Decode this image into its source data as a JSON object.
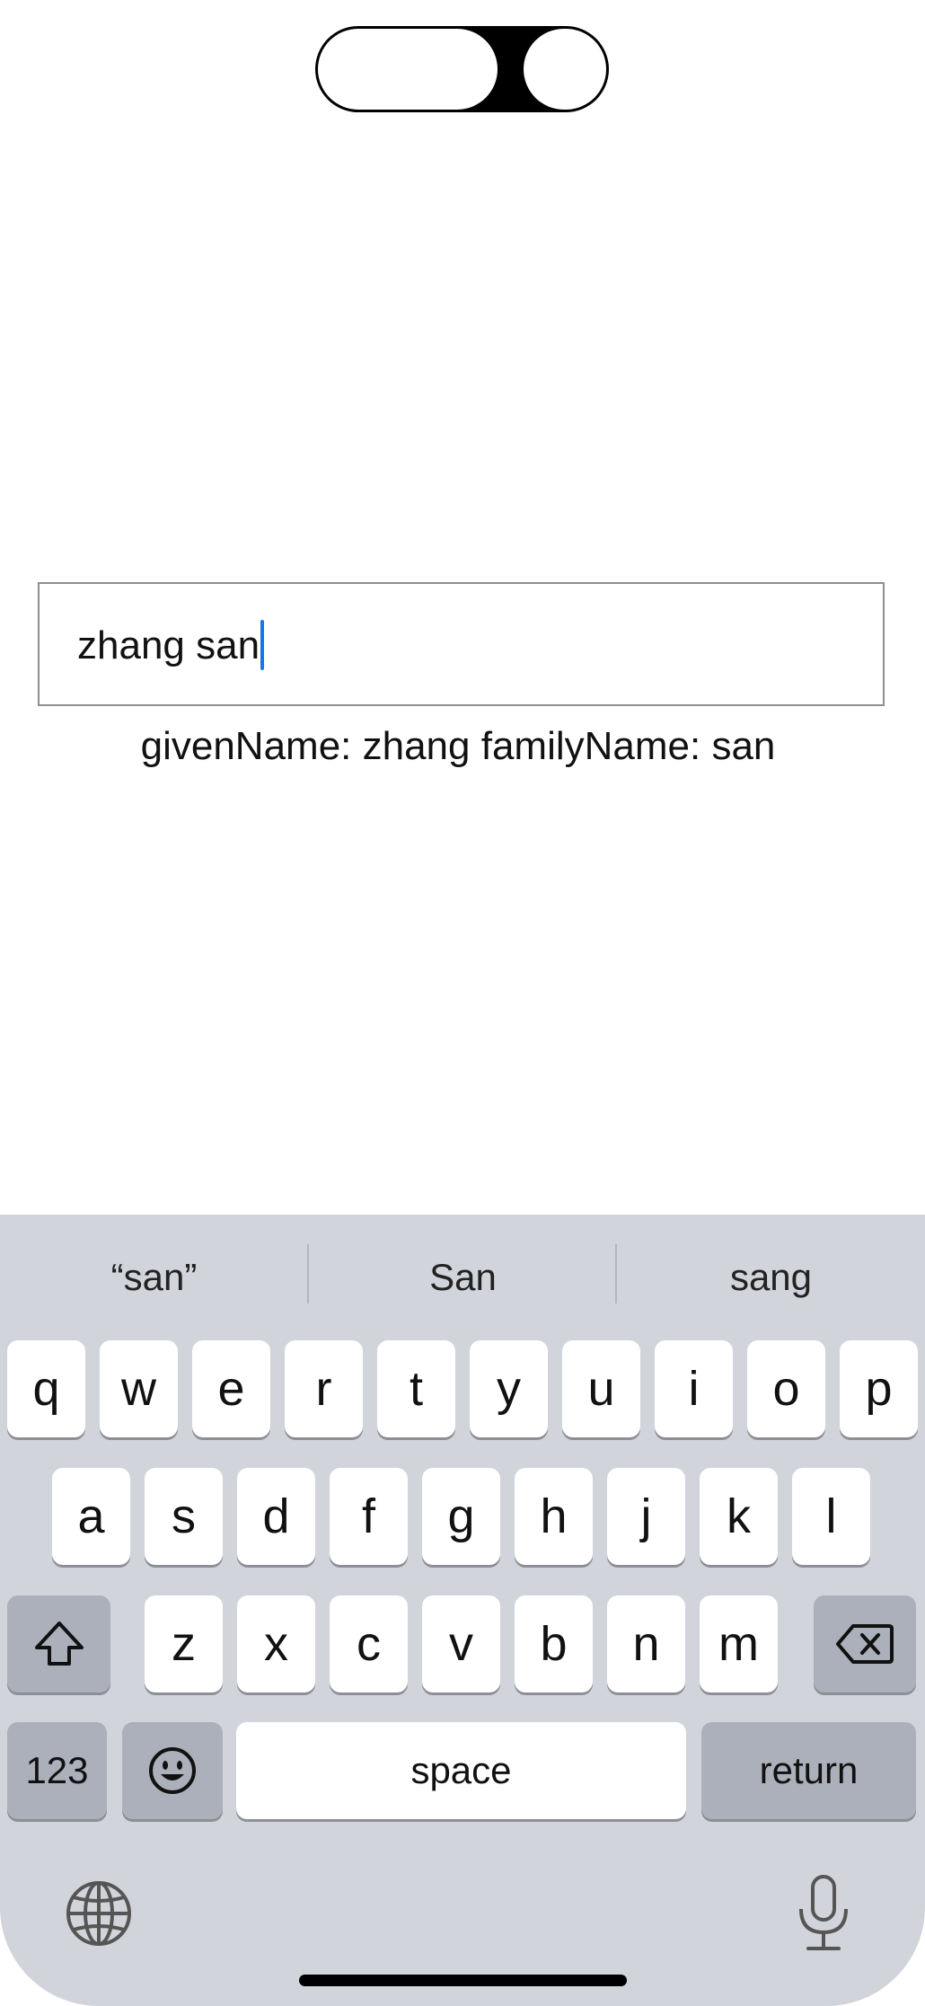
{
  "textfield": {
    "value": "zhang san"
  },
  "result": "givenName: zhang familyName: san",
  "keyboard": {
    "suggestions": [
      "“san”",
      "San",
      "sang"
    ],
    "row1": [
      "q",
      "w",
      "e",
      "r",
      "t",
      "y",
      "u",
      "i",
      "o",
      "p"
    ],
    "row2": [
      "a",
      "s",
      "d",
      "f",
      "g",
      "h",
      "j",
      "k",
      "l"
    ],
    "row3": [
      "z",
      "x",
      "c",
      "v",
      "b",
      "n",
      "m"
    ],
    "numbers_label": "123",
    "space_label": "space",
    "return_label": "return"
  },
  "icons": {
    "shift": "shift-icon",
    "delete": "delete-icon",
    "emoji": "emoji-icon",
    "globe": "globe-icon",
    "mic": "microphone-icon"
  }
}
